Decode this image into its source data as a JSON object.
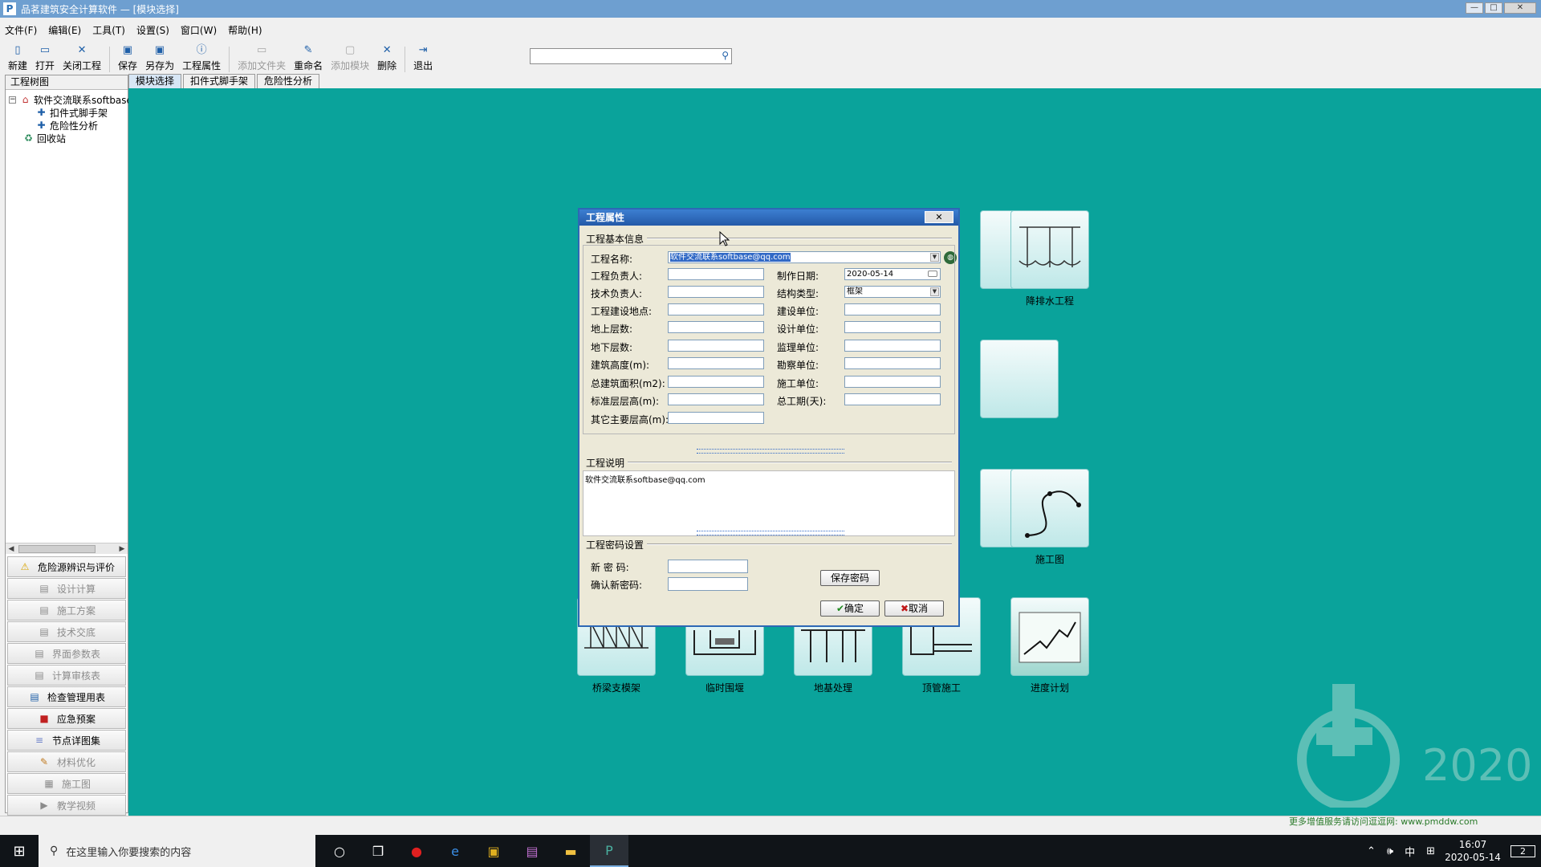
{
  "window": {
    "title": "品茗建筑安全计算软件 — [模块选择]",
    "controls": [
      "minimize",
      "maximize",
      "close"
    ]
  },
  "menu": [
    "文件(F)",
    "编辑(E)",
    "工具(T)",
    "设置(S)",
    "窗口(W)",
    "帮助(H)"
  ],
  "toolbar": {
    "new": "新建",
    "open": "打开",
    "close_project": "关闭工程",
    "save": "保存",
    "save_as": "另存为",
    "project_props": "工程属性",
    "add_folder": "添加文件夹",
    "rename": "重命名",
    "add_module": "添加模块",
    "delete": "删除",
    "exit": "退出",
    "search_value": ""
  },
  "left_panel": {
    "header": "工程树图",
    "tree": [
      {
        "label": "软件交流联系softbase",
        "icon": "house-icon"
      },
      {
        "label": "扣件式脚手架",
        "icon": "plus-icon"
      },
      {
        "label": "危险性分析",
        "icon": "plus-icon"
      },
      {
        "label": "回收站",
        "icon": "recycle-icon"
      }
    ],
    "nav": [
      {
        "label": "危险源辨识与评价",
        "enabled": true
      },
      {
        "label": "设计计算",
        "enabled": false
      },
      {
        "label": "施工方案",
        "enabled": false
      },
      {
        "label": "技术交底",
        "enabled": false
      },
      {
        "label": "界面参数表",
        "enabled": false
      },
      {
        "label": "计算审核表",
        "enabled": false
      },
      {
        "label": "检查管理用表",
        "enabled": true
      },
      {
        "label": "应急预案",
        "enabled": true
      },
      {
        "label": "节点详图集",
        "enabled": true
      },
      {
        "label": "材料优化",
        "enabled": false
      },
      {
        "label": "施工图",
        "enabled": false
      },
      {
        "label": "教学视频",
        "enabled": false
      }
    ]
  },
  "tabs": [
    "模块选择",
    "扣件式脚手架",
    "危险性分析"
  ],
  "modules": {
    "m1": "降排水工程",
    "m2": "施工图",
    "m3": "桥梁支模架",
    "m4": "临时围堰",
    "m5": "地基处理",
    "m6": "顶管施工",
    "m7": "进度计划"
  },
  "dialog": {
    "title": "工程属性",
    "close": "✕",
    "group_basic": "工程基本信息",
    "group_desc": "工程说明",
    "group_pwd": "工程密码设置",
    "fields": {
      "name_label": "工程名称:",
      "name_value": "软件交流联系softbase@qq.com",
      "manager_label": "工程负责人:",
      "date_label": "制作日期:",
      "date_value": "2020-05-14",
      "tech_label": "技术负责人:",
      "struct_label": "结构类型:",
      "struct_value": "框架",
      "site_label": "工程建设地点:",
      "builder_label": "建设单位:",
      "above_label": "地上层数:",
      "design_label": "设计单位:",
      "below_label": "地下层数:",
      "supervise_label": "监理单位:",
      "height_label": "建筑高度(m):",
      "survey_label": "勘察单位:",
      "area_label": "总建筑面积(m2):",
      "construct_label": "施工单位:",
      "floor_label": "标准层层高(m):",
      "period_label": "总工期(天):",
      "other_label": "其它主要层高(m):"
    },
    "desc_value": "软件交流联系softbase@qq.com",
    "pwd": {
      "new_label": "新 密 码:",
      "confirm_label": "确认新密码:",
      "save": "保存密码"
    },
    "ok": "确定",
    "cancel": "取消"
  },
  "watermark_year": "2020",
  "promo": "更多增值服务请访问逗逗网: www.pmddw.com",
  "taskbar": {
    "search_placeholder": "在这里输入你要搜索的内容",
    "ime": "中",
    "time": "16:07",
    "date": "2020-05-14",
    "notif": "2"
  },
  "colors": {
    "workspace": "#0aa39b",
    "titlebar": "#6e9fd0",
    "dialog_title": "#2459a8"
  }
}
